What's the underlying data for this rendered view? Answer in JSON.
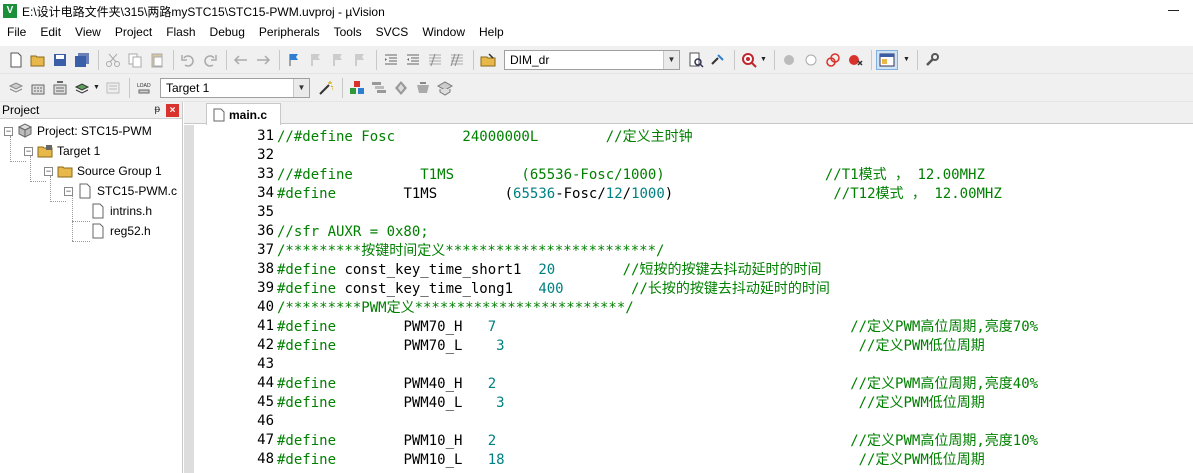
{
  "window": {
    "title": "E:\\设计电路文件夹\\315\\两路mySTC15\\STC15-PWM.uvproj - µVision",
    "app_icon_letter": "V"
  },
  "menu": [
    "File",
    "Edit",
    "View",
    "Project",
    "Flash",
    "Debug",
    "Peripherals",
    "Tools",
    "SVCS",
    "Window",
    "Help"
  ],
  "toolbar1": {
    "find_combo_value": "DIM_dr"
  },
  "toolbar2": {
    "target_combo_value": "Target 1"
  },
  "project_panel": {
    "title": "Project",
    "pin_glyph": "ᵽ",
    "close_glyph": "×",
    "tree": [
      {
        "label": "Project: STC15-PWM",
        "expander": "−",
        "icon": "project-icon"
      },
      {
        "label": "Target 1",
        "expander": "−",
        "icon": "target-folder-icon"
      },
      {
        "label": "Source Group 1",
        "expander": "−",
        "icon": "folder-icon"
      },
      {
        "label": "STC15-PWM.c",
        "expander": "−",
        "icon": "c-file-icon"
      },
      {
        "label": "intrins.h",
        "expander": "",
        "icon": "header-file-icon"
      },
      {
        "label": "reg52.h",
        "expander": "",
        "icon": "header-file-icon"
      }
    ]
  },
  "editor": {
    "tab_label": "main.c",
    "lines": [
      {
        "no": "31",
        "segs": [
          {
            "t": "//#define Fosc        24000000L        //定义主时钟",
            "c": "c-green"
          }
        ]
      },
      {
        "no": "32",
        "segs": []
      },
      {
        "no": "33",
        "segs": [
          {
            "t": "//#define        T1MS        (65536-Fosc/1000)                   //T1模式 ， 12.00MHZ",
            "c": "c-green"
          }
        ]
      },
      {
        "no": "34",
        "segs": [
          {
            "t": "#define",
            "c": "c-green"
          },
          {
            "t": "        T1MS        (",
            "c": "c-black"
          },
          {
            "t": "65536",
            "c": "c-teal"
          },
          {
            "t": "-Fosc/",
            "c": "c-black"
          },
          {
            "t": "12",
            "c": "c-teal"
          },
          {
            "t": "/",
            "c": "c-black"
          },
          {
            "t": "1000",
            "c": "c-teal"
          },
          {
            "t": ")                   ",
            "c": "c-black"
          },
          {
            "t": "//T12模式 ， 12.00MHZ",
            "c": "c-green"
          }
        ]
      },
      {
        "no": "35",
        "segs": []
      },
      {
        "no": "36",
        "segs": [
          {
            "t": "//sfr AUXR = 0x80;",
            "c": "c-green"
          }
        ]
      },
      {
        "no": "37",
        "segs": [
          {
            "t": "/*********按键时间定义*************************/",
            "c": "c-green"
          }
        ]
      },
      {
        "no": "38",
        "segs": [
          {
            "t": "#define",
            "c": "c-green"
          },
          {
            "t": " const_key_time_short1  ",
            "c": "c-black"
          },
          {
            "t": "20",
            "c": "c-teal"
          },
          {
            "t": "        ",
            "c": "c-black"
          },
          {
            "t": "//短按的按键去抖动延时的时间",
            "c": "c-green"
          }
        ]
      },
      {
        "no": "39",
        "segs": [
          {
            "t": "#define",
            "c": "c-green"
          },
          {
            "t": " const_key_time_long1   ",
            "c": "c-black"
          },
          {
            "t": "400",
            "c": "c-teal"
          },
          {
            "t": "        ",
            "c": "c-black"
          },
          {
            "t": "//长按的按键去抖动延时的时间",
            "c": "c-green"
          }
        ]
      },
      {
        "no": "40",
        "segs": [
          {
            "t": "/*********PWM定义*************************/",
            "c": "c-green"
          }
        ]
      },
      {
        "no": "41",
        "segs": [
          {
            "t": "#define",
            "c": "c-green"
          },
          {
            "t": "        PWM70_H   ",
            "c": "c-black"
          },
          {
            "t": "7",
            "c": "c-teal"
          },
          {
            "t": "                                          ",
            "c": "c-black"
          },
          {
            "t": "//定义PWM高位周期,亮度70%",
            "c": "c-green"
          }
        ]
      },
      {
        "no": "42",
        "segs": [
          {
            "t": "#define",
            "c": "c-green"
          },
          {
            "t": "        PWM70_L    ",
            "c": "c-black"
          },
          {
            "t": "3",
            "c": "c-teal"
          },
          {
            "t": "                                          ",
            "c": "c-black"
          },
          {
            "t": "//定义PWM低位周期",
            "c": "c-green"
          }
        ]
      },
      {
        "no": "43",
        "segs": []
      },
      {
        "no": "44",
        "segs": [
          {
            "t": "#define",
            "c": "c-green"
          },
          {
            "t": "        PWM40_H   ",
            "c": "c-black"
          },
          {
            "t": "2",
            "c": "c-teal"
          },
          {
            "t": "                                          ",
            "c": "c-black"
          },
          {
            "t": "//定义PWM高位周期,亮度40%",
            "c": "c-green"
          }
        ]
      },
      {
        "no": "45",
        "segs": [
          {
            "t": "#define",
            "c": "c-green"
          },
          {
            "t": "        PWM40_L    ",
            "c": "c-black"
          },
          {
            "t": "3",
            "c": "c-teal"
          },
          {
            "t": "                                          ",
            "c": "c-black"
          },
          {
            "t": "//定义PWM低位周期",
            "c": "c-green"
          }
        ]
      },
      {
        "no": "46",
        "segs": []
      },
      {
        "no": "47",
        "segs": [
          {
            "t": "#define",
            "c": "c-green"
          },
          {
            "t": "        PWM10_H   ",
            "c": "c-black"
          },
          {
            "t": "2",
            "c": "c-teal"
          },
          {
            "t": "                                          ",
            "c": "c-black"
          },
          {
            "t": "//定义PWM高位周期,亮度10%",
            "c": "c-green"
          }
        ]
      },
      {
        "no": "48",
        "segs": [
          {
            "t": "#define",
            "c": "c-green"
          },
          {
            "t": "        PWM10_L   ",
            "c": "c-black"
          },
          {
            "t": "18",
            "c": "c-teal"
          },
          {
            "t": "                                          ",
            "c": "c-black"
          },
          {
            "t": "//定义PWM低位周期",
            "c": "c-green"
          }
        ]
      }
    ]
  }
}
